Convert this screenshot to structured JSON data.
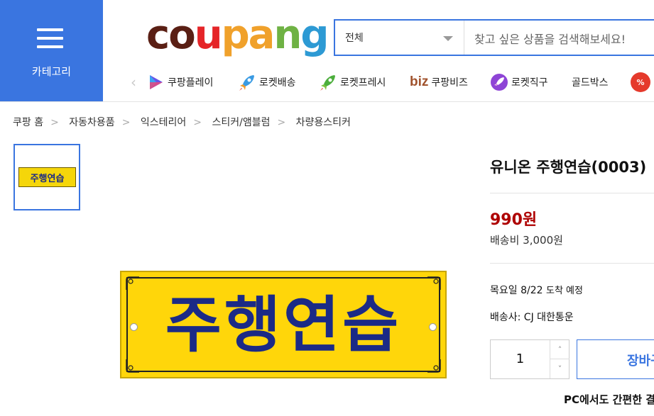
{
  "header": {
    "category_label": "카테고리",
    "logo_text": "coupang",
    "logo_colors": [
      "#5a1f14",
      "#5a1f14",
      "#e52528",
      "#f0a12b",
      "#f0a12b",
      "#6fb244",
      "#2d9ad4"
    ],
    "search": {
      "category": "전체",
      "placeholder": "찾고 싶은 상품을 검색해보세요!"
    },
    "nav": [
      {
        "label": "쿠팡플레이",
        "icon": "play-icon"
      },
      {
        "label": "로켓배송",
        "icon": "rocket-icon"
      },
      {
        "label": "로켓프레시",
        "icon": "rocket-fresh-icon"
      },
      {
        "label": "쿠팡비즈",
        "icon": "biz-icon",
        "prefix": "biz"
      },
      {
        "label": "로켓직구",
        "icon": "rocket-global-icon"
      },
      {
        "label": "골드박스",
        "icon": ""
      },
      {
        "label": "%",
        "icon": "discount-icon"
      }
    ]
  },
  "breadcrumb": [
    "쿠팡 홈",
    "자동차용품",
    "익스테리어",
    "스티커/앰블럼",
    "차량용스티커"
  ],
  "product": {
    "thumbnail_text": "주행연습",
    "image_text": "주행연습",
    "title": "유니온 주행연습(0003)",
    "price": "990원",
    "shipping_fee": "배송비 3,000원",
    "arrival_date": "목요일 8/22",
    "arrival_suffix": "도착 예정",
    "carrier": "배송사: CJ 대한통운",
    "quantity": "1",
    "cart_button": "장바구니",
    "pc_note": "PC에서도 간편한 결제"
  },
  "colors": {
    "accent": "#3a75e0",
    "price": "#ae0000",
    "sign_bg": "#ffd60a",
    "sign_text": "#1b2a86"
  }
}
